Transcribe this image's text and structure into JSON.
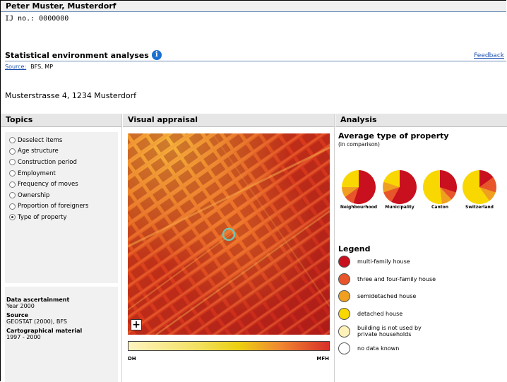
{
  "header": {
    "person": "Peter Muster, Musterdorf",
    "ij_no": "IJ no.: 0000000",
    "section_title": "Statistical environment analyses",
    "feedback": "Feedback",
    "source_label": "Source:",
    "source_value": "BFS, MP",
    "address": "Musterstrasse 4, 1234 Musterdorf"
  },
  "columns": {
    "topics": "Topics",
    "visual": "Visual appraisal",
    "analysis": "Analysis"
  },
  "topics": [
    {
      "label": "Deselect items",
      "selected": false
    },
    {
      "label": "Age structure",
      "selected": false
    },
    {
      "label": "Construction period",
      "selected": false
    },
    {
      "label": "Employment",
      "selected": false
    },
    {
      "label": "Frequency of moves",
      "selected": false
    },
    {
      "label": "Ownership",
      "selected": false
    },
    {
      "label": "Proportion of foreigners",
      "selected": false
    },
    {
      "label": "Type of property",
      "selected": true
    }
  ],
  "meta": {
    "data_heading": "Data ascertainment",
    "data_value": "Year 2000",
    "source_heading": "Source",
    "source_value": "GEOSTAT (2000), BFS",
    "carto_heading": "Cartographical material",
    "carto_value": "1997 - 2000"
  },
  "visual": {
    "zoom_label": "+",
    "scale_left": "DH",
    "scale_right": "MFH"
  },
  "analysis": {
    "title": "Average type of property",
    "subtitle": "(in comparison)",
    "legend_title": "Legend"
  },
  "colors": {
    "multi_family": "#c8101e",
    "three_four_family": "#e8552a",
    "semidetached": "#f0a020",
    "detached": "#f8d800",
    "not_private": "#fff2b8",
    "no_data": "#ffffff"
  },
  "chart_data": {
    "type": "pie",
    "categories": [
      "multi-family house",
      "three and four-family house",
      "semidetached house",
      "detached house",
      "building is not used by private households",
      "no data known"
    ],
    "pies": [
      {
        "name": "Neighbourhood",
        "values": [
          55,
          10,
          10,
          25,
          0,
          0
        ]
      },
      {
        "name": "Municipality",
        "values": [
          58,
          12,
          10,
          20,
          0,
          0
        ]
      },
      {
        "name": "Canton",
        "values": [
          30,
          8,
          10,
          52,
          0,
          0
        ]
      },
      {
        "name": "Switzerland",
        "values": [
          15,
          15,
          10,
          60,
          0,
          0
        ]
      }
    ],
    "legend": [
      "multi-family house",
      "three and four-family house",
      "semidetached house",
      "detached house",
      "building is not used by private households",
      "no data known"
    ]
  }
}
